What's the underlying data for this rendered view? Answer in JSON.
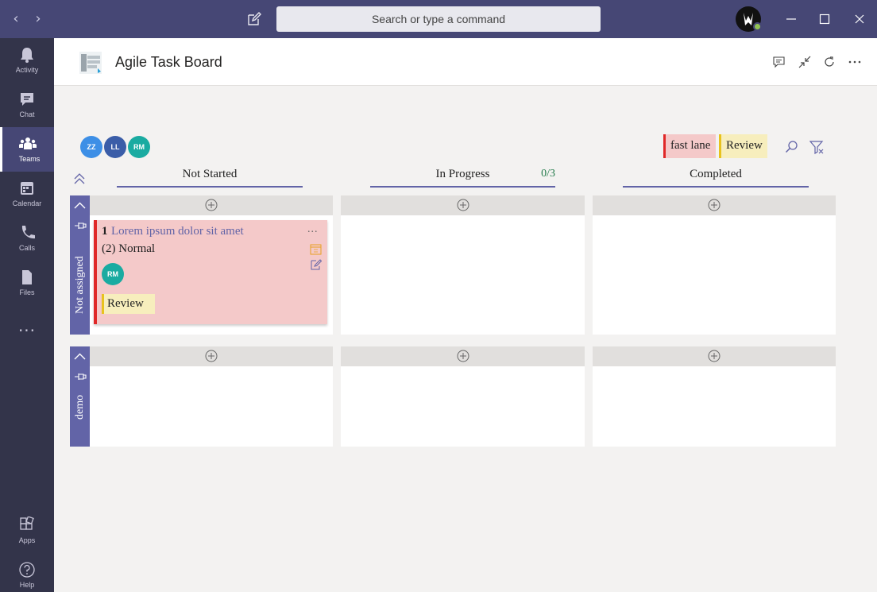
{
  "titlebar": {
    "search_placeholder": "Search or type a command"
  },
  "rail": {
    "items": [
      {
        "label": "Activity",
        "icon": "bell-icon"
      },
      {
        "label": "Chat",
        "icon": "chat-icon"
      },
      {
        "label": "Teams",
        "icon": "teams-icon",
        "active": true
      },
      {
        "label": "Calendar",
        "icon": "calendar-icon"
      },
      {
        "label": "Calls",
        "icon": "phone-icon"
      },
      {
        "label": "Files",
        "icon": "file-icon"
      }
    ],
    "more": "...",
    "bottom": [
      {
        "label": "Apps",
        "icon": "apps-icon"
      },
      {
        "label": "Help",
        "icon": "help-icon"
      }
    ]
  },
  "app": {
    "title": "Agile Task Board"
  },
  "board": {
    "members": [
      {
        "initials": "ZZ",
        "color": "#3d8fe6"
      },
      {
        "initials": "LL",
        "color": "#3a5da8"
      },
      {
        "initials": "RM",
        "color": "#1aaba1"
      }
    ],
    "legend": [
      {
        "label": "fast lane",
        "bg": "#f4c9c9",
        "bar": "#e02828"
      },
      {
        "label": "Review",
        "bg": "#f7eebd",
        "bar": "#e8c21e"
      }
    ],
    "columns": [
      {
        "label": "Not Started",
        "wip": ""
      },
      {
        "label": "In Progress",
        "wip": "0/3"
      },
      {
        "label": "Completed",
        "wip": ""
      }
    ],
    "lanes": [
      {
        "label": "Not assigned"
      },
      {
        "label": "demo"
      }
    ],
    "card": {
      "id": "1",
      "title": "Lorem ipsum dolor sit amet",
      "priority": "(2) Normal",
      "assignee": "RM",
      "tag": "Review",
      "more": "..."
    }
  }
}
